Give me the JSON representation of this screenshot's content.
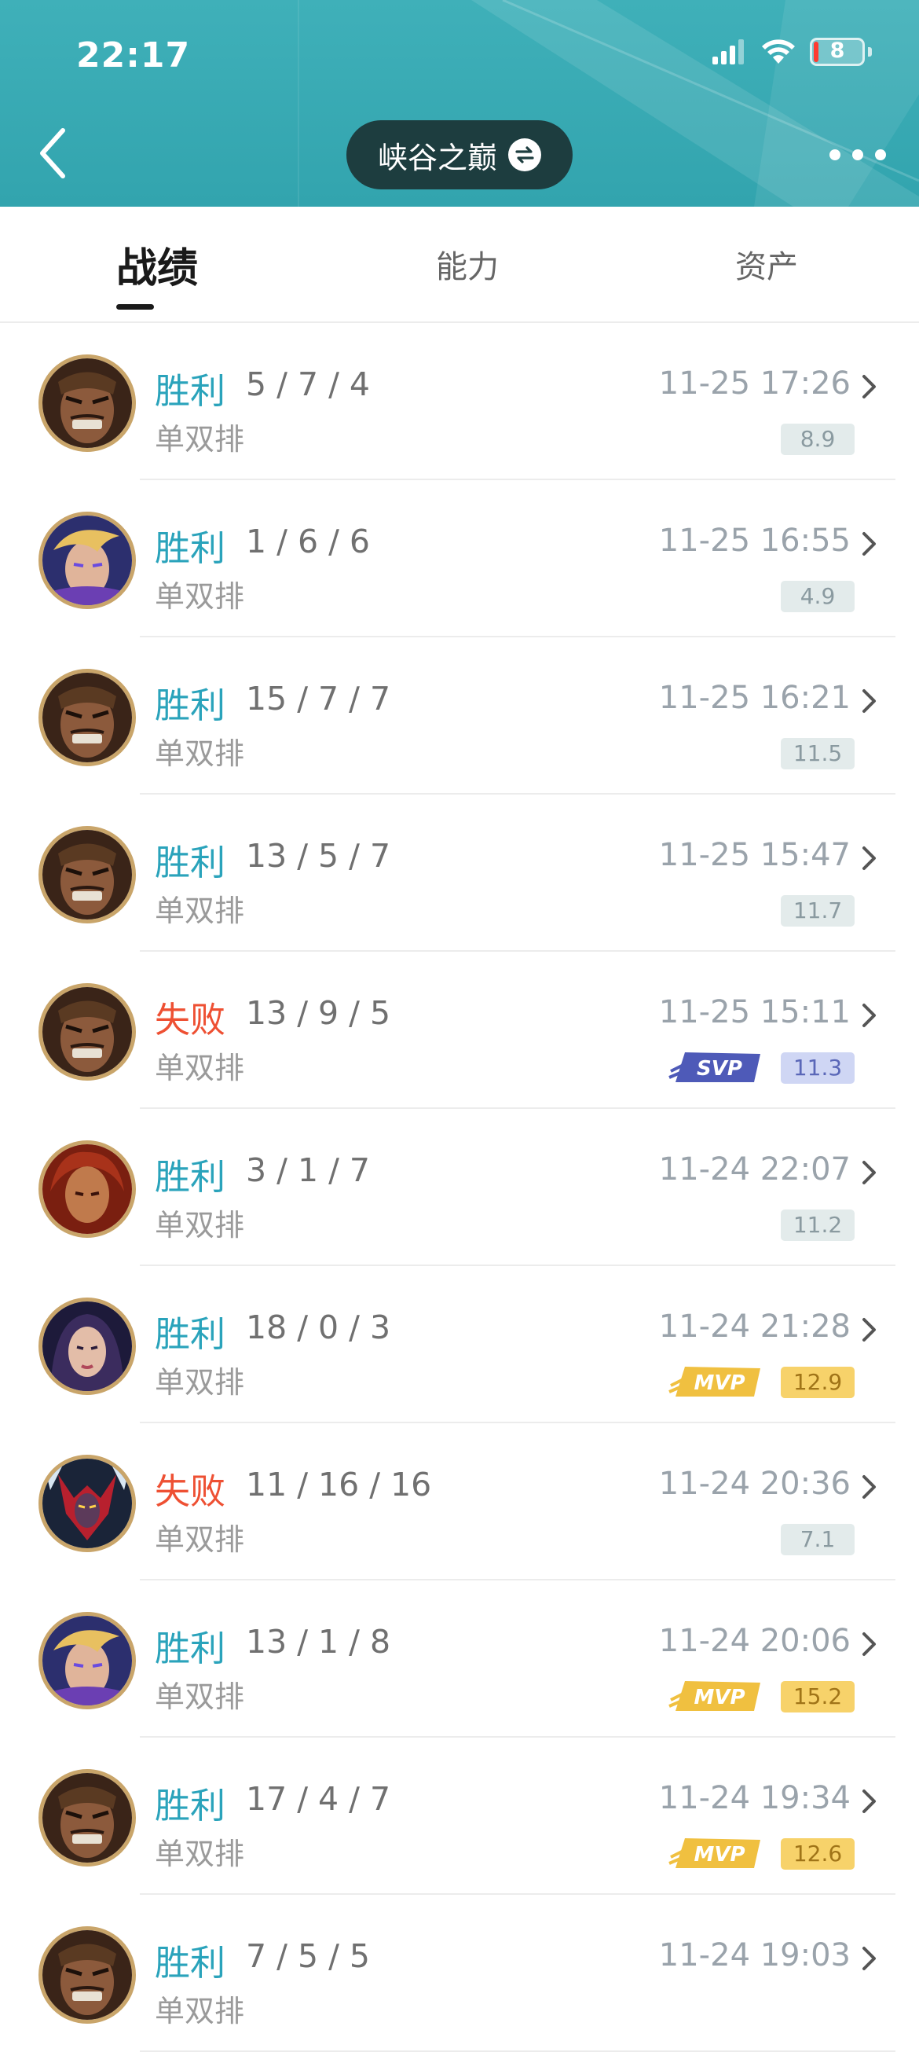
{
  "status_bar": {
    "time": "22:17",
    "battery": "8"
  },
  "header": {
    "title": "峡谷之巅"
  },
  "tabs": [
    {
      "label": "战绩",
      "active": true
    },
    {
      "label": "能力",
      "active": false
    },
    {
      "label": "资产",
      "active": false
    }
  ],
  "matches": [
    {
      "result": "胜利",
      "outcome": "win",
      "kda": "5 / 7 / 4",
      "mode": "单双排",
      "time": "11-25 17:26",
      "score": "8.9",
      "badge": "",
      "champion_icon": "warrior-portrait"
    },
    {
      "result": "胜利",
      "outcome": "win",
      "kda": "1 / 6 / 6",
      "mode": "单双排",
      "time": "11-25 16:55",
      "score": "4.9",
      "badge": "",
      "champion_icon": "blonde-mage-portrait"
    },
    {
      "result": "胜利",
      "outcome": "win",
      "kda": "15 / 7 / 7",
      "mode": "单双排",
      "time": "11-25 16:21",
      "score": "11.5",
      "badge": "",
      "champion_icon": "warrior-portrait"
    },
    {
      "result": "胜利",
      "outcome": "win",
      "kda": "13 / 5 / 7",
      "mode": "单双排",
      "time": "11-25 15:47",
      "score": "11.7",
      "badge": "",
      "champion_icon": "warrior-portrait"
    },
    {
      "result": "失败",
      "outcome": "lose",
      "kda": "13 / 9 / 5",
      "mode": "单双排",
      "time": "11-25 15:11",
      "score": "11.3",
      "badge": "SVP",
      "champion_icon": "warrior-portrait"
    },
    {
      "result": "胜利",
      "outcome": "win",
      "kda": "3 / 1 / 7",
      "mode": "单双排",
      "time": "11-24 22:07",
      "score": "11.2",
      "badge": "",
      "champion_icon": "fire-heroine-portrait"
    },
    {
      "result": "胜利",
      "outcome": "win",
      "kda": "18 / 0 / 3",
      "mode": "单双排",
      "time": "11-24 21:28",
      "score": "12.9",
      "badge": "MVP",
      "champion_icon": "dark-haired-heroine-portrait"
    },
    {
      "result": "失败",
      "outcome": "lose",
      "kda": "11 / 16 / 16",
      "mode": "单双排",
      "time": "11-24 20:36",
      "score": "7.1",
      "badge": "",
      "champion_icon": "demon-knight-portrait"
    },
    {
      "result": "胜利",
      "outcome": "win",
      "kda": "13 / 1 / 8",
      "mode": "单双排",
      "time": "11-24 20:06",
      "score": "15.2",
      "badge": "MVP",
      "champion_icon": "blonde-mage-portrait"
    },
    {
      "result": "胜利",
      "outcome": "win",
      "kda": "17 / 4 / 7",
      "mode": "单双排",
      "time": "11-24 19:34",
      "score": "12.6",
      "badge": "MVP",
      "champion_icon": "warrior-portrait"
    },
    {
      "result": "胜利",
      "outcome": "win",
      "kda": "7 / 5 / 5",
      "mode": "单双排",
      "time": "11-24 19:03",
      "score": "",
      "badge": "",
      "champion_icon": "warrior-portrait"
    }
  ],
  "colors": {
    "win": "#2aa3bb",
    "lose": "#ee5033",
    "header": "#3fb0b9",
    "mvp": "#f7d26a",
    "svp": "#cfd6f4"
  }
}
